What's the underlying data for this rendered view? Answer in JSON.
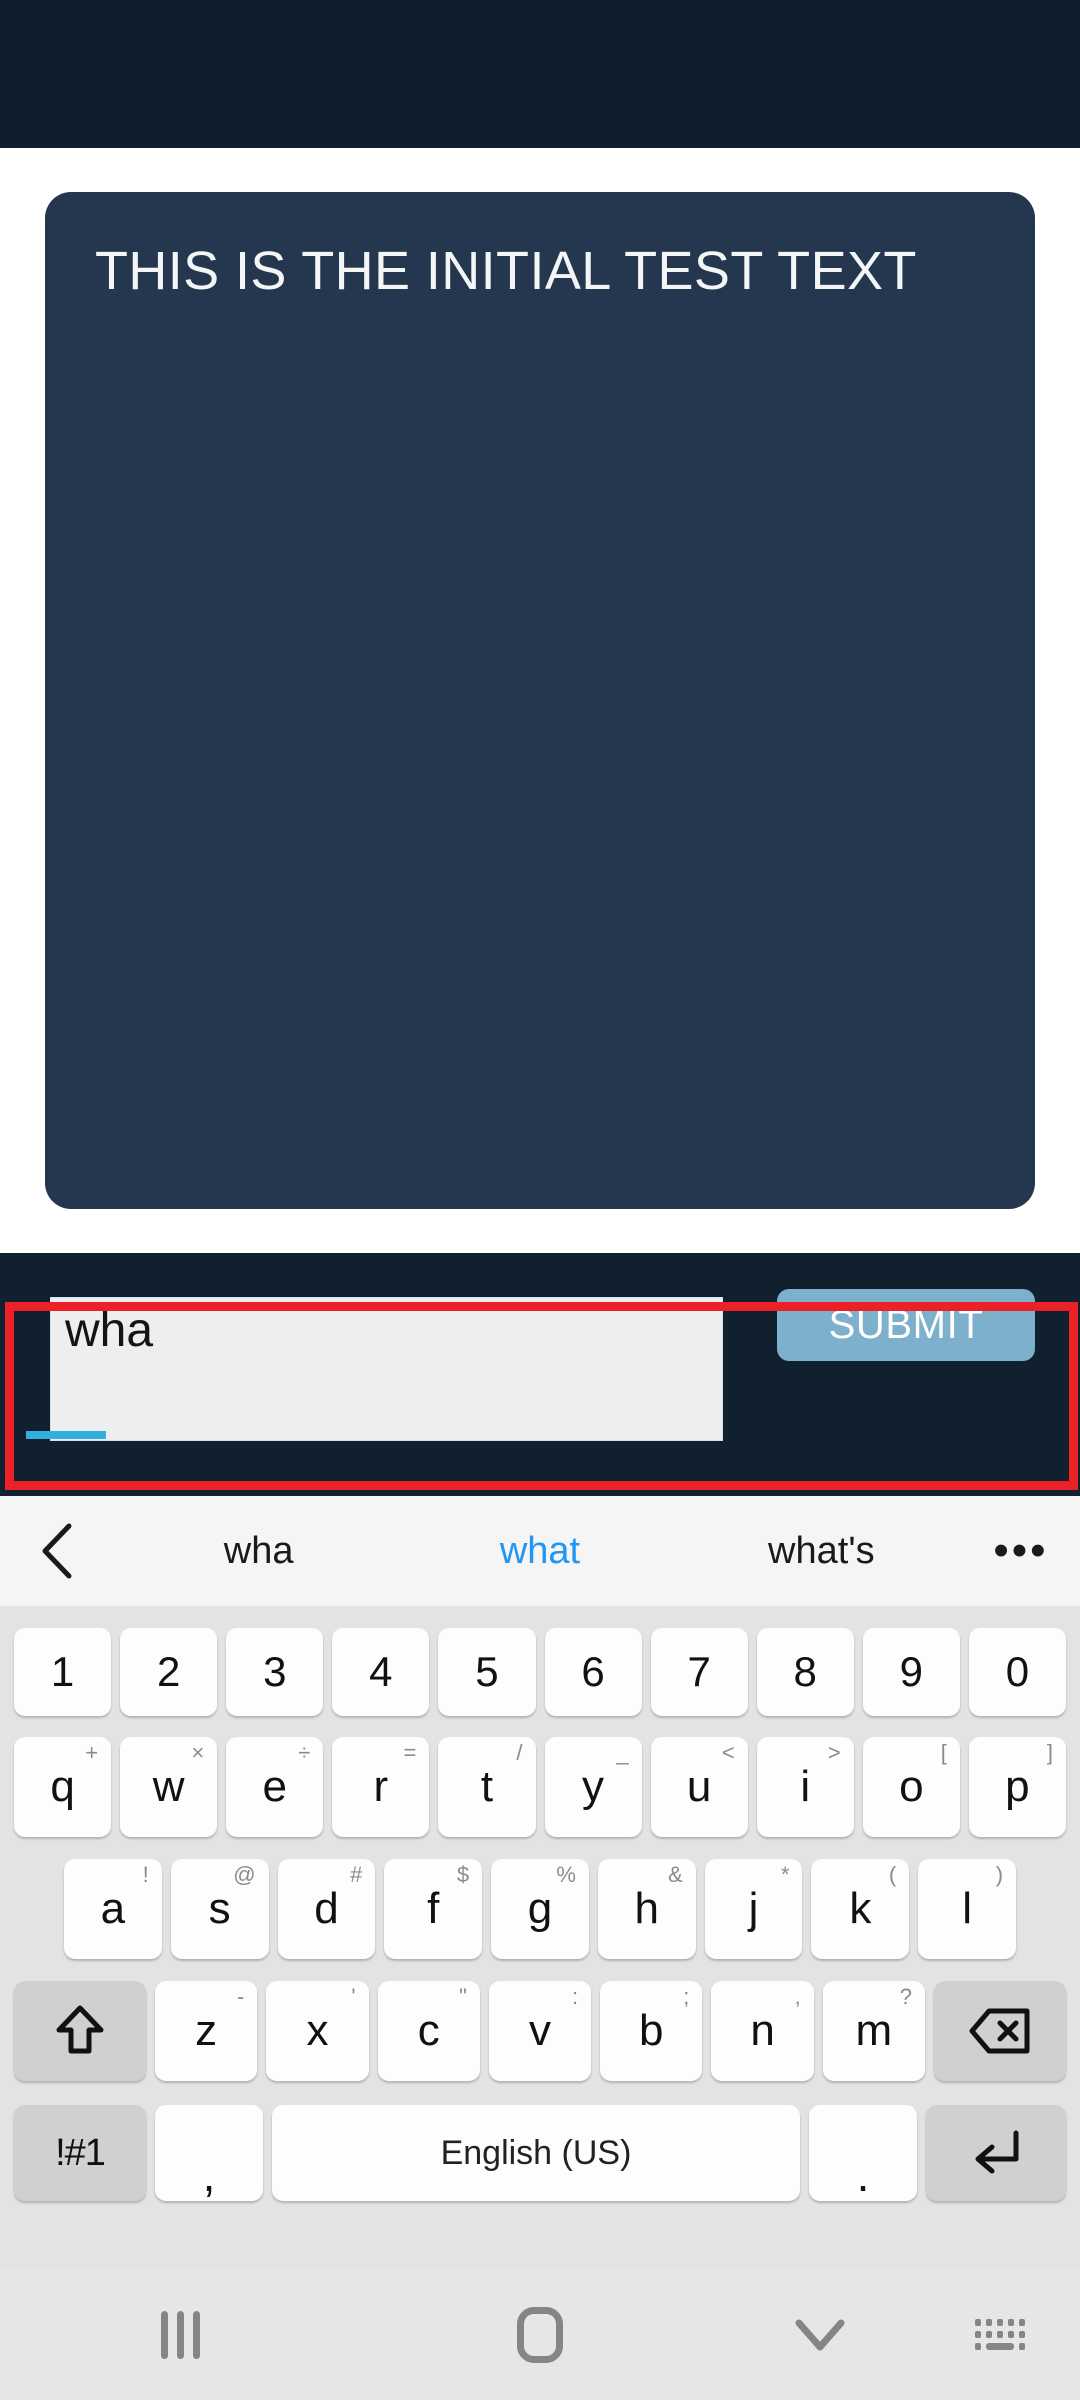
{
  "app": {
    "display_text": "THIS IS THE INITIAL TEST TEXT"
  },
  "input": {
    "value": "wha",
    "placeholder": "",
    "submit_label": "SUBMIT"
  },
  "highlight": {
    "color": "#ec2027"
  },
  "colors": {
    "status_bar": "#0f1e2e",
    "card": "#24374e",
    "input_bar": "#10202f",
    "submit": "#7cb0cd",
    "accent": "#31b0e0",
    "suggestion_active": "#2196f3",
    "keyboard_bg": "#e3e3e3",
    "key_bg": "#fdfdfd",
    "modifier_key_bg": "#d0d0d0"
  },
  "suggestions": {
    "back_icon": "chevron-left-icon",
    "items": [
      {
        "label": "wha",
        "active": false
      },
      {
        "label": "what",
        "active": true
      },
      {
        "label": "what's",
        "active": false
      }
    ],
    "more_label": "•••"
  },
  "keyboard": {
    "language_label": "English (US)",
    "rows": {
      "numbers": [
        {
          "label": "1"
        },
        {
          "label": "2"
        },
        {
          "label": "3"
        },
        {
          "label": "4"
        },
        {
          "label": "5"
        },
        {
          "label": "6"
        },
        {
          "label": "7"
        },
        {
          "label": "8"
        },
        {
          "label": "9"
        },
        {
          "label": "0"
        }
      ],
      "top": [
        {
          "label": "q",
          "sup": "+"
        },
        {
          "label": "w",
          "sup": "×"
        },
        {
          "label": "e",
          "sup": "÷"
        },
        {
          "label": "r",
          "sup": "="
        },
        {
          "label": "t",
          "sup": "/"
        },
        {
          "label": "y",
          "sup": "_"
        },
        {
          "label": "u",
          "sup": "<"
        },
        {
          "label": "i",
          "sup": ">"
        },
        {
          "label": "o",
          "sup": "["
        },
        {
          "label": "p",
          "sup": "]"
        }
      ],
      "home": [
        {
          "label": "a",
          "sup": "!"
        },
        {
          "label": "s",
          "sup": "@"
        },
        {
          "label": "d",
          "sup": "#"
        },
        {
          "label": "f",
          "sup": "$"
        },
        {
          "label": "g",
          "sup": "%"
        },
        {
          "label": "h",
          "sup": "&"
        },
        {
          "label": "j",
          "sup": "*"
        },
        {
          "label": "k",
          "sup": "("
        },
        {
          "label": "l",
          "sup": ")"
        }
      ],
      "bottom": [
        {
          "label": "z",
          "sup": "-"
        },
        {
          "label": "x",
          "sup": "'"
        },
        {
          "label": "c",
          "sup": "\""
        },
        {
          "label": "v",
          "sup": ":"
        },
        {
          "label": "b",
          "sup": ";"
        },
        {
          "label": "n",
          "sup": ","
        },
        {
          "label": "m",
          "sup": "?"
        }
      ],
      "space_row": {
        "symbols_label": "!#1",
        "comma_label": ",",
        "period_label": ".",
        "shift_icon": "shift-up-arrow-icon",
        "backspace_icon": "backspace-icon",
        "enter_icon": "enter-return-icon"
      }
    }
  },
  "nav_bar": {
    "recent_icon": "recent-apps-icon",
    "home_icon": "home-icon",
    "hide_keyboard_icon": "chevron-down-icon",
    "keyboard_switch_icon": "keyboard-switch-icon"
  }
}
